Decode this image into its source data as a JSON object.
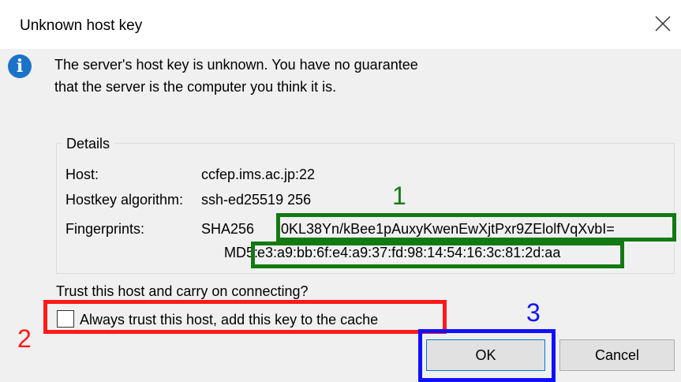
{
  "dialog": {
    "title": "Unknown host key",
    "message": "The server's host key is unknown. You have no guarantee that the server is the computer you think it is.",
    "details_label": "Details",
    "host_label": "Host:",
    "host_value": "ccfep.ims.ac.jp:22",
    "algo_label": "Hostkey algorithm:",
    "algo_value": "ssh-ed25519 256",
    "fp_label": "Fingerprints:",
    "sha_label": "SHA256",
    "sha_value": "0KL38Yn/kBee1pAuxyKwenEwXjtPxr9ZElolfVqXvbI=",
    "md5_label": "MD5:",
    "md5_value": "e3:a9:bb:6f:e4:a9:37:fd:98:14:54:16:3c:81:2d:aa",
    "question": "Trust this host and carry on connecting?",
    "checkbox_label": "Always trust this host, add this key to the cache",
    "ok": "OK",
    "cancel": "Cancel"
  },
  "annotations": {
    "a1": "1",
    "a2": "2",
    "a3": "3"
  },
  "colors": {
    "green": "#137a13",
    "red": "#ff1a1a",
    "blue": "#1010ff",
    "info": "#1a73c8"
  },
  "icons": {
    "info": "info-icon",
    "close": "close-icon"
  }
}
